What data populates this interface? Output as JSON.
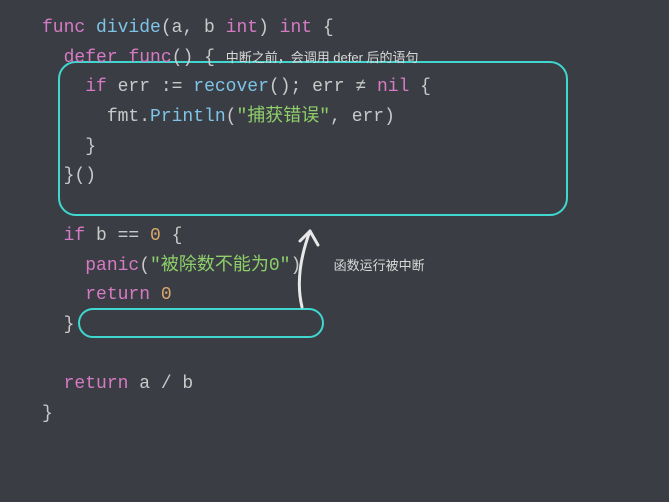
{
  "code": {
    "l1": {
      "func": "func",
      "name": "divide",
      "params": "(a, b ",
      "int1": "int",
      "close_paren": ") ",
      "int2": "int",
      "brace": " {"
    },
    "l2": {
      "defer": "defer",
      "func": "func",
      "parens": "()",
      "brace": " {"
    },
    "l3": {
      "if": "if",
      "err": " err ",
      "assign": ":=",
      "recover": "recover",
      "parens": "(); ",
      "err2": "err ",
      "neq": "≠",
      "nil": " nil",
      "brace": " {"
    },
    "l4": {
      "fmt": "fmt",
      "dot": ".",
      "println": "Println",
      "open": "(",
      "str": "\"捕获错误\"",
      "comma": ", ",
      "arg": "err",
      "close": ")"
    },
    "l5": {
      "brace": "}"
    },
    "l6": {
      "brace": "}()"
    },
    "l7": {
      "if": "if",
      "b": " b ",
      "eq": "==",
      "zero": " 0",
      "brace": " {"
    },
    "l8": {
      "panic": "panic",
      "open": "(",
      "str": "\"被除数不能为0\"",
      "close": ")"
    },
    "l9": {
      "return": "return",
      "zero": " 0"
    },
    "l10": {
      "brace": "}"
    },
    "l11": {
      "return": "return",
      "expr": " a / b"
    },
    "l12": {
      "brace": "}"
    }
  },
  "annotations": {
    "defer_note": "中断之前，会调用 defer 后的语句",
    "panic_note": "函数运行被中断"
  }
}
